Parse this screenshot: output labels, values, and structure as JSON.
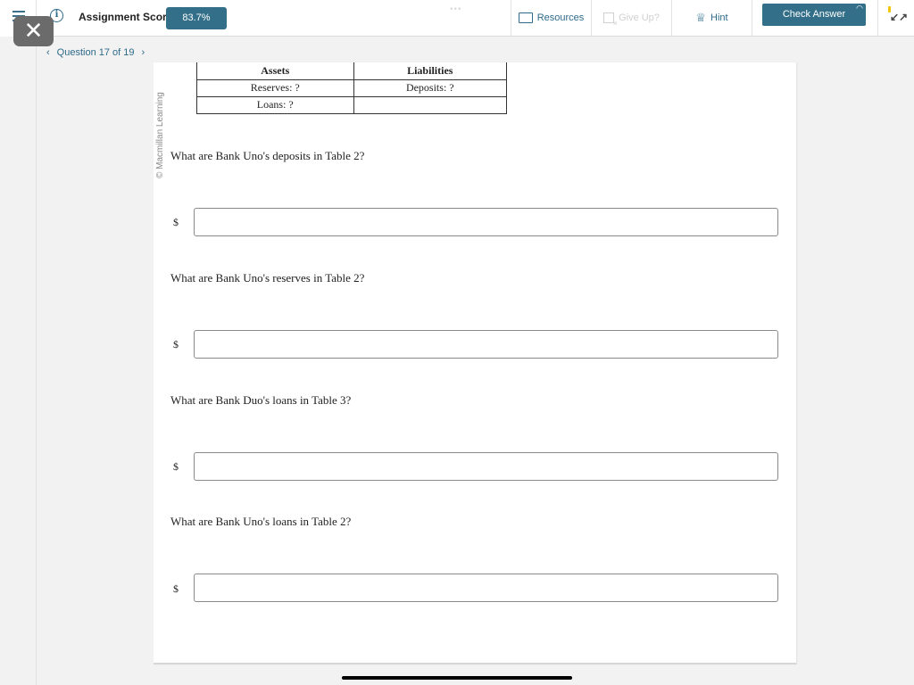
{
  "topbar": {
    "score_label": "Assignment Score:",
    "score_value": "83.7%",
    "resources_label": "Resources",
    "give_up_label": "Give Up?",
    "hint_label": "Hint",
    "check_answer_label": "Check Answer",
    "close_glyph": "✕",
    "info_glyph": "i",
    "dots": "•••"
  },
  "nav": {
    "prev_glyph": "‹",
    "next_glyph": "›",
    "question_label": "Question 17 of 19"
  },
  "content": {
    "copyright": "© Macmillan Learning",
    "table": {
      "headers": [
        "Assets",
        "Liabilities"
      ],
      "rows": [
        [
          "Reserves: ?",
          "Deposits: ?"
        ],
        [
          "Loans: ?",
          ""
        ]
      ]
    },
    "currency_symbol": "$",
    "questions": [
      {
        "text": "What are Bank Uno's deposits in Table 2?",
        "value": ""
      },
      {
        "text": "What are Bank Uno's reserves in Table 2?",
        "value": ""
      },
      {
        "text": "What are Bank Duo's loans in Table 3?",
        "value": ""
      },
      {
        "text": "What are Bank Uno's loans in Table 2?",
        "value": ""
      }
    ]
  }
}
